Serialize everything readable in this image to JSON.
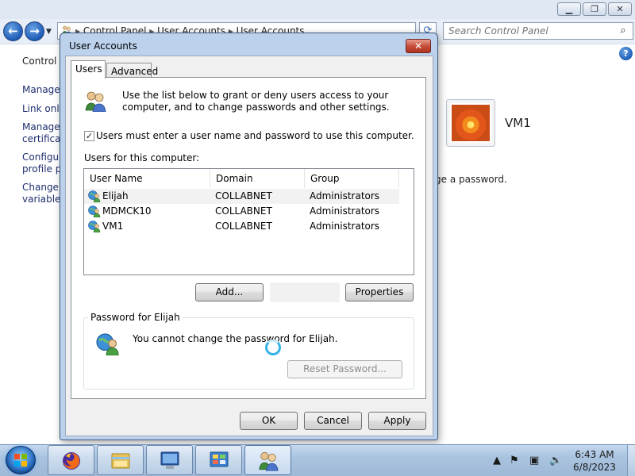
{
  "control_panel": {
    "address_parts": [
      "Control Panel",
      "User Accounts",
      "User Accounts"
    ],
    "search_placeholder": "Search Control Panel",
    "left_links": [
      [
        "Control P"
      ],
      [
        "Manage"
      ],
      [
        "Link onli"
      ],
      [
        "Manage",
        "certificat"
      ],
      [
        "Configur",
        "profile pr"
      ],
      [
        "Change r",
        "variables"
      ]
    ],
    "account_name": "VM1",
    "change_text": "ge a password."
  },
  "dialog": {
    "title": "User Accounts",
    "tabs": [
      "Users",
      "Advanced"
    ],
    "intro": "Use the list below to grant or deny users access to your computer, and to change passwords and other settings.",
    "must_enter_label": "Users must enter a user name and password to use this computer.",
    "must_enter_checked": true,
    "users_heading": "Users for this computer:",
    "columns": [
      "User Name",
      "Domain",
      "Group"
    ],
    "users": [
      {
        "name": "Elijah",
        "domain": "COLLABNET",
        "group": "Administrators",
        "selected": true
      },
      {
        "name": "MDMCK10",
        "domain": "COLLABNET",
        "group": "Administrators",
        "selected": false
      },
      {
        "name": "VM1",
        "domain": "COLLABNET",
        "group": "Administrators",
        "selected": false
      }
    ],
    "add_button": "Add...",
    "properties_button": "Properties",
    "password_group": "Password for Elijah",
    "password_message": "You cannot change the password for Elijah.",
    "reset_button": "Reset Password...",
    "ok_button": "OK",
    "cancel_button": "Cancel",
    "apply_button": "Apply"
  },
  "taskbar": {
    "time": "6:43 AM",
    "date": "6/8/2023",
    "pinned": [
      "firefox-icon",
      "file-explorer-icon",
      "remote-desktop-icon",
      "control-panel-icon",
      "user-accounts-icon"
    ]
  },
  "colors": {
    "dialog_frame": "#bcd2ec",
    "close_button": "#c44a36",
    "link_text": "#1e2e6e",
    "taskbar": "#a9c3df"
  }
}
